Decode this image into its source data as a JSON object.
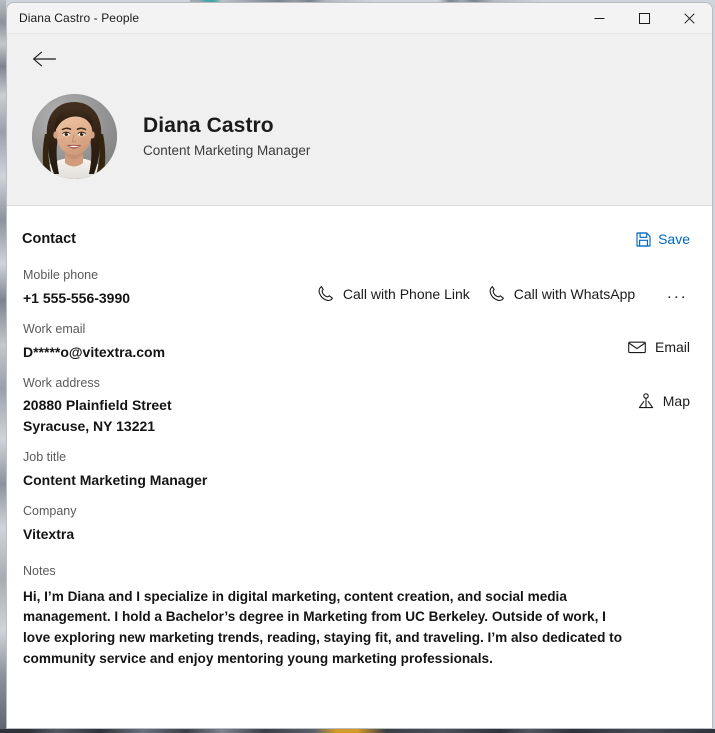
{
  "window": {
    "title": "Diana Castro - People",
    "controls": {
      "minimize_label": "Minimize",
      "maximize_label": "Maximize",
      "close_label": "Close"
    }
  },
  "header": {
    "back_label": "Back",
    "name": "Diana Castro",
    "subtitle": "Content Marketing Manager",
    "avatar_alt": "Diana Castro profile photo"
  },
  "contact": {
    "heading": "Contact",
    "save_label": "Save"
  },
  "fields": {
    "mobile_phone": {
      "label": "Mobile phone",
      "value": "+1 555-556-3990",
      "actions": {
        "phone_link": "Call with Phone Link",
        "whatsapp": "Call with WhatsApp",
        "overflow": "..."
      }
    },
    "work_email": {
      "label": "Work email",
      "value": "D*****o@vitextra.com",
      "action": "Email"
    },
    "work_address": {
      "label": "Work address",
      "value": "20880 Plainfield Street\nSyracuse, NY 13221",
      "action": "Map"
    },
    "job_title": {
      "label": "Job title",
      "value": "Content Marketing Manager"
    },
    "company": {
      "label": "Company",
      "value": "Vitextra"
    },
    "notes": {
      "label": "Notes",
      "value": "Hi, I’m Diana and I specialize in digital marketing, content creation, and social media management. I hold a Bachelor’s degree in Marketing from UC Berkeley. Outside of work, I love exploring new marketing trends, reading, staying fit, and traveling. I’m also dedicated to community service and enjoy mentoring young marketing professionals."
    }
  },
  "colors": {
    "accent": "#0067c0",
    "header_background": "#f0f0f0",
    "title_bar": "#f3f3f3",
    "body": "#ffffff",
    "label_text": "#5a5a5a",
    "value_text": "#141414"
  },
  "icons": {
    "back": "arrow-left-icon",
    "save": "floppy-disk-icon",
    "call": "phone-handset-icon",
    "email": "envelope-icon",
    "map": "map-pin-icon",
    "overflow": "ellipsis-icon"
  }
}
